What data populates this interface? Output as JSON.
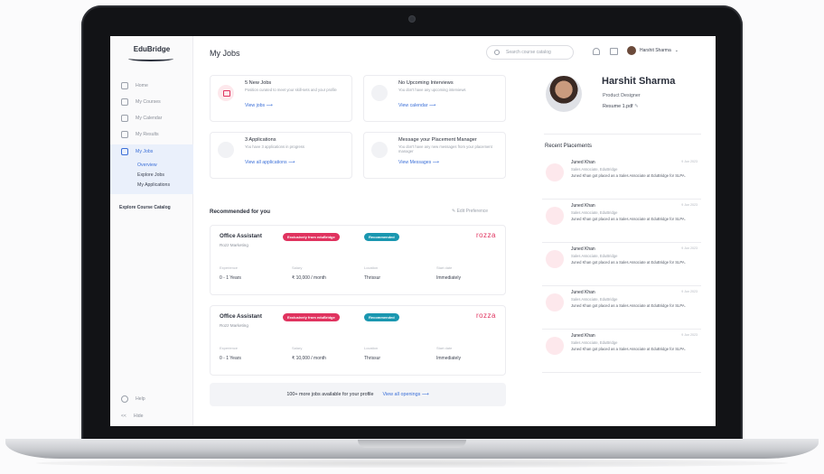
{
  "app": {
    "logo": "EduBridge"
  },
  "sidebar": {
    "items": [
      {
        "label": "Home",
        "icon": "home-icon"
      },
      {
        "label": "My Courses",
        "icon": "book-icon"
      },
      {
        "label": "My Calendar",
        "icon": "calendar-icon"
      },
      {
        "label": "My Results",
        "icon": "clipboard-icon"
      },
      {
        "label": "My Jobs",
        "icon": "briefcase-icon"
      }
    ],
    "sub_items": [
      "Overview",
      "Explore Jobs",
      "My Applications"
    ],
    "explore": "Explore Course Catalog",
    "help": "Help",
    "hide": "Hide"
  },
  "header": {
    "title": "My Jobs",
    "search_placeholder": "Search course catalog",
    "user_name": "Harshit Sharma"
  },
  "cards": [
    {
      "title": "5 New Jobs",
      "desc": "Position curated to meet your skill-sets and your profile",
      "link": "View jobs"
    },
    {
      "title": "No Upcoming Interviews",
      "desc": "You don't have any upcoming interviews",
      "link": "View calendar"
    },
    {
      "title": "3 Applications",
      "desc": "You have 3 applications in progress",
      "link": "View all applications"
    },
    {
      "title": "Message your Placement Manager",
      "desc": "You don't have any new messages from your placement manager",
      "link": "View Messages"
    }
  ],
  "recommended": {
    "title": "Recommended for you",
    "edit": "Edit Preference",
    "jobs": [
      {
        "title": "Office Assistant",
        "company": "Rozz Marketing",
        "tag1": "Exclusively from eduBridge",
        "tag2": "Recommended",
        "brand": "rozza",
        "exp_label": "Experience",
        "exp": "0 - 1 Years",
        "salary_label": "Salary",
        "salary": "₹ 10,000 / month",
        "loc_label": "Location",
        "loc": "Thrissur",
        "start_label": "Start date",
        "start": "Immediately"
      },
      {
        "title": "Office Assistant",
        "company": "Rozz Marketing",
        "tag1": "Exclusively from eduBridge",
        "tag2": "Recommended",
        "brand": "rozza",
        "exp_label": "Experience",
        "exp": "0 - 1 Years",
        "salary_label": "Salary",
        "salary": "₹ 10,000 / month",
        "loc_label": "Location",
        "loc": "Thrissur",
        "start_label": "Start date",
        "start": "Immediately"
      }
    ],
    "more_text": "100+ more jobs available for your profile",
    "more_link": "View all openings"
  },
  "profile": {
    "name": "Harshit Sharma",
    "role": "Product Designer",
    "resume": "Resume 1.pdf"
  },
  "placements": {
    "title": "Recent Placements",
    "items": [
      {
        "name": "Juned Khan",
        "date": "9 Jun 2023",
        "sub": "Sales Associate, EduBridge",
        "text": "Juned Khan got placed as a Sales Associate at EduBridge for SLPA."
      },
      {
        "name": "Juned Khan",
        "date": "9 Jun 2023",
        "sub": "Sales Associate, EduBridge",
        "text": "Juned Khan got placed as a Sales Associate at EduBridge for SLPA."
      },
      {
        "name": "Juned Khan",
        "date": "9 Jun 2023",
        "sub": "Sales Associate, EduBridge",
        "text": "Juned Khan got placed as a Sales Associate at EduBridge for SLPA."
      },
      {
        "name": "Juned Khan",
        "date": "9 Jun 2023",
        "sub": "Sales Associate, EduBridge",
        "text": "Juned Khan got placed as a Sales Associate at EduBridge for SLPA."
      },
      {
        "name": "Juned Khan",
        "date": "9 Jun 2023",
        "sub": "Sales Associate, EduBridge",
        "text": "Juned Khan got placed as a Sales Associate at EduBridge for SLPA."
      }
    ]
  },
  "colors": {
    "accent": "#3b6fd8",
    "brand_pink": "#e0335f",
    "teal": "#1a97b0"
  }
}
